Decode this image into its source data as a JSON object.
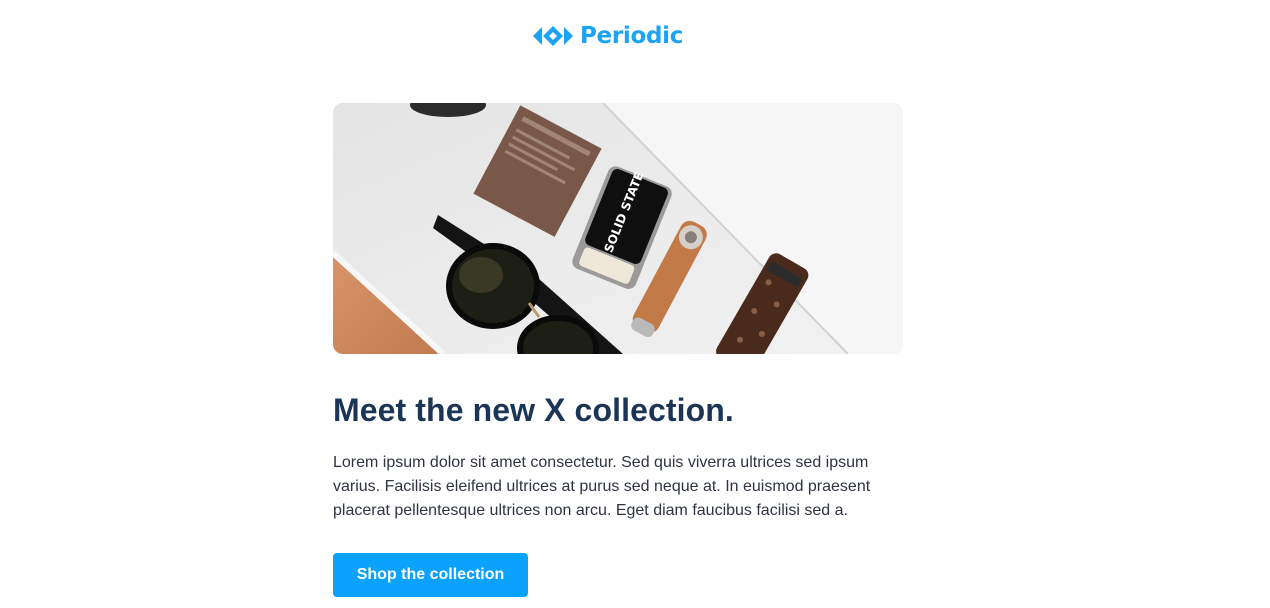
{
  "brand": {
    "name": "Periodic",
    "color": "#1ba3f4",
    "icon": "diamond-logo-icon"
  },
  "hero": {
    "image": "product-flatlay-image",
    "package_text": "SOLID STATE"
  },
  "content": {
    "headline": "Meet the new X collection.",
    "headline_color": "#1b3556",
    "body": "Lorem ipsum dolor sit amet consectetur. Sed quis viverra ultrices sed ipsum varius. Facilisis eleifend ultrices at purus sed neque at. In euismod praesent placerat pellentesque ultrices non arcu. Eget diam faucibus facilisi sed a."
  },
  "cta": {
    "label": "Shop the collection",
    "color": "#0aa2fb"
  }
}
